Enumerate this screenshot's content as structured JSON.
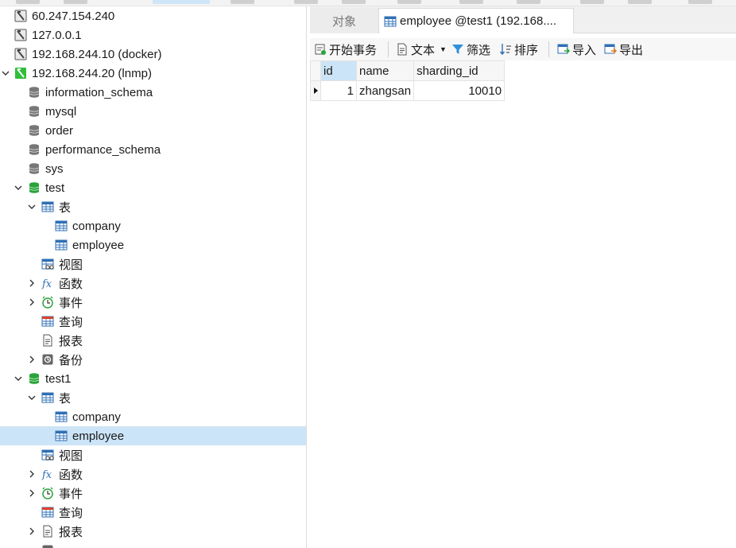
{
  "colors": {
    "accent_selection": "#cce4f7",
    "db_open": "#2aa33a",
    "conn_closed": "#555555",
    "conn_open": "#2fbf3a",
    "table_icon": "#2f6fb5"
  },
  "tree": {
    "connections": [
      {
        "label": "60.247.154.240",
        "icon": "connection-icon",
        "open": false
      },
      {
        "label": "127.0.0.1",
        "icon": "connection-icon",
        "open": false
      },
      {
        "label": "192.168.244.10  (docker)",
        "icon": "connection-icon",
        "open": false
      },
      {
        "label": "192.168.244.20  (lnmp)",
        "icon": "connection-icon",
        "open": true
      }
    ],
    "databases_closed": [
      "information_schema",
      "mysql",
      "order",
      "performance_schema",
      "sys"
    ],
    "db_test": {
      "label": "test",
      "tables_label": "表",
      "tables": [
        "company",
        "employee"
      ],
      "views_label": "视图",
      "functions_label": "函数",
      "events_label": "事件",
      "queries_label": "查询",
      "reports_label": "报表",
      "backups_label": "备份"
    },
    "db_test1": {
      "label": "test1",
      "tables_label": "表",
      "tables": [
        "company",
        "employee"
      ],
      "views_label": "视图",
      "functions_label": "函数",
      "events_label": "事件",
      "queries_label": "查询",
      "reports_label": "报表"
    }
  },
  "tabs": {
    "objects": "对象",
    "active": "employee @test1 (192.168...."
  },
  "toolbar": {
    "begin_transaction": "开始事务",
    "text": "文本",
    "filter": "筛选",
    "sort": "排序",
    "import": "导入",
    "export": "导出"
  },
  "grid": {
    "columns": [
      "id",
      "name",
      "sharding_id"
    ],
    "rows": [
      [
        "1",
        "zhangsan",
        "10010"
      ]
    ]
  }
}
